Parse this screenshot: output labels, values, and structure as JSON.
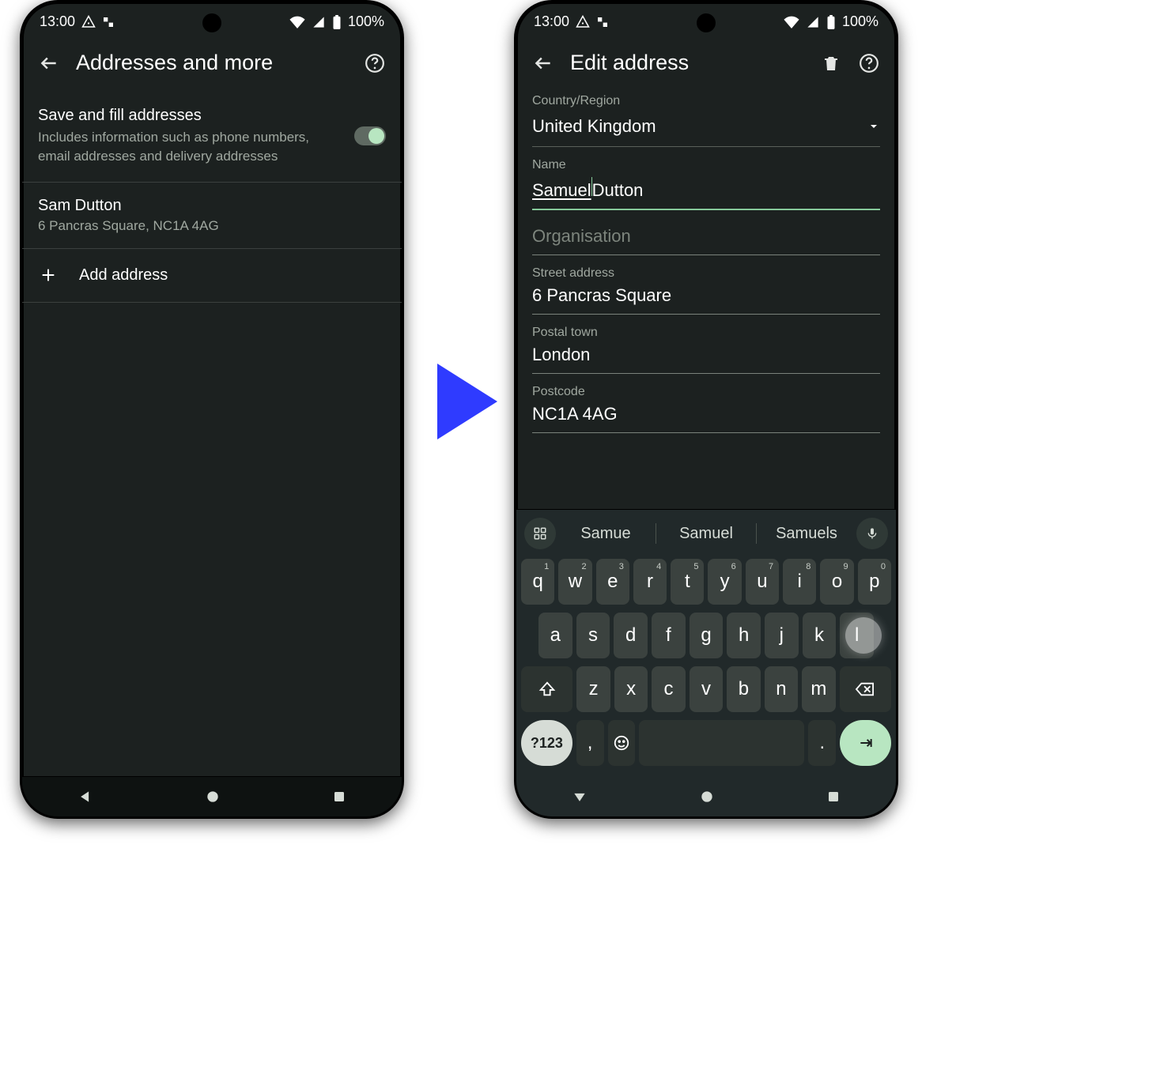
{
  "status": {
    "time": "13:00",
    "battery": "100%"
  },
  "left": {
    "title": "Addresses and more",
    "toggle": {
      "title": "Save and fill addresses",
      "sub": "Includes information such as phone numbers, email addresses and delivery addresses"
    },
    "address": {
      "name": "Sam Dutton",
      "line": "6 Pancras Square, NC1A 4AG"
    },
    "add": "Add address"
  },
  "right": {
    "title": "Edit address",
    "country_label": "Country/Region",
    "country_value": "United Kingdom",
    "name_label": "Name",
    "name_word1": "Samuel",
    "name_word2": " Dutton",
    "org_label": "Organisation",
    "street_label": "Street address",
    "street_value": "6 Pancras Square",
    "town_label": "Postal town",
    "town_value": "London",
    "postcode_label": "Postcode",
    "postcode_value": "NC1A 4AG"
  },
  "keyboard": {
    "suggestions": [
      "Samue",
      "Samuel",
      "Samuels"
    ],
    "row1": [
      {
        "k": "q",
        "s": "1"
      },
      {
        "k": "w",
        "s": "2"
      },
      {
        "k": "e",
        "s": "3"
      },
      {
        "k": "r",
        "s": "4"
      },
      {
        "k": "t",
        "s": "5"
      },
      {
        "k": "y",
        "s": "6"
      },
      {
        "k": "u",
        "s": "7"
      },
      {
        "k": "i",
        "s": "8"
      },
      {
        "k": "o",
        "s": "9"
      },
      {
        "k": "p",
        "s": "0"
      }
    ],
    "row2": [
      "a",
      "s",
      "d",
      "f",
      "g",
      "h",
      "j",
      "k",
      "l"
    ],
    "row3": [
      "z",
      "x",
      "c",
      "v",
      "b",
      "n",
      "m"
    ],
    "num": "?123",
    "comma": ",",
    "period": "."
  }
}
